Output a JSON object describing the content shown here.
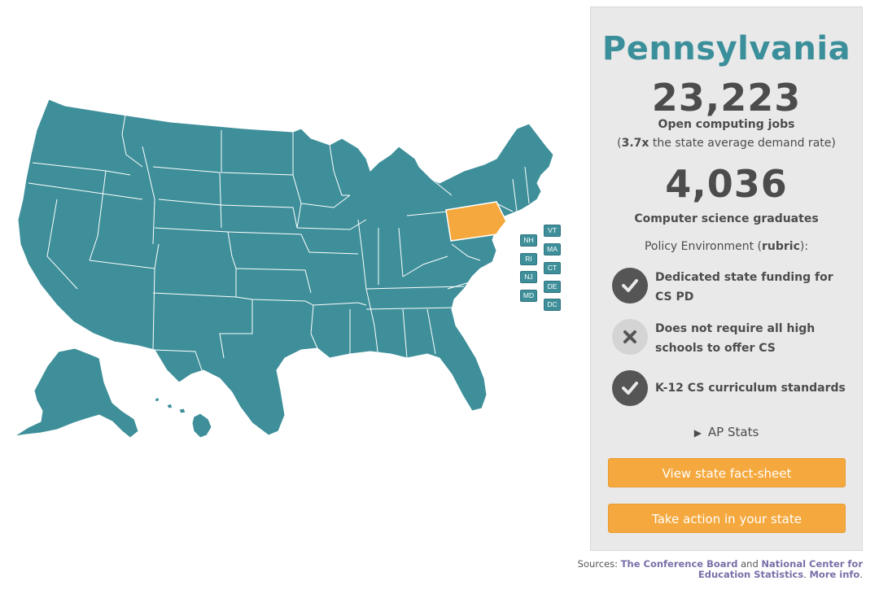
{
  "map": {
    "default_color": "#3e8f9a",
    "selected_color": "#f5a83d",
    "selected_state": "Pennsylvania",
    "small_state_buttons": [
      "VT",
      "NH",
      "MA",
      "RI",
      "CT",
      "NJ",
      "DE",
      "MD",
      "DC"
    ]
  },
  "panel": {
    "state_name": "Pennsylvania",
    "jobs": {
      "value": "23,223",
      "label": "Open computing jobs",
      "rate_open": "(",
      "rate_value": "3.7x",
      "rate_text": " the state average demand rate)"
    },
    "grads": {
      "value": "4,036",
      "label": "Computer science graduates"
    },
    "policy_heading": {
      "prefix": "Policy Environment (",
      "rubric": "rubric",
      "suffix": "):"
    },
    "policies": [
      {
        "status": "yes",
        "icon": "check-icon",
        "text": "Dedicated state funding for CS PD"
      },
      {
        "status": "no",
        "icon": "x-icon",
        "text": "Does not require all high schools to offer CS"
      },
      {
        "status": "yes",
        "icon": "check-icon",
        "text": "K-12 CS curriculum standards"
      }
    ],
    "ap_stats_label": "AP Stats",
    "buttons": {
      "fact_sheet": "View state fact-sheet",
      "take_action": "Take action in your state"
    }
  },
  "sources": {
    "prefix": "Sources: ",
    "link1": "The Conference Board",
    "and": " and ",
    "link2": "National Center for Education Statistics",
    "dot": ". ",
    "more": "More info",
    "end": "."
  },
  "colors": {
    "accent_teal": "#3a8f9b",
    "button_orange": "#f5a83d",
    "link_purple": "#7a6fa8"
  }
}
